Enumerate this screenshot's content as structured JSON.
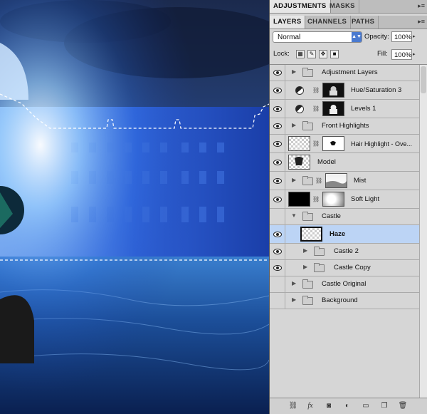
{
  "panel_tabs_top": [
    {
      "label": "ADJUSTMENTS",
      "active": true
    },
    {
      "label": "MASKS",
      "active": false
    }
  ],
  "panel_tabs": [
    {
      "label": "LAYERS",
      "active": true
    },
    {
      "label": "CHANNELS",
      "active": false
    },
    {
      "label": "PATHS",
      "active": false
    }
  ],
  "blend_mode": "Normal",
  "opacity_label": "Opacity:",
  "opacity_value": "100%",
  "lock_label": "Lock:",
  "fill_label": "Fill:",
  "fill_value": "100%",
  "layers": [
    {
      "name": "Adjustment Layers",
      "type": "group",
      "visible": true
    },
    {
      "name": "Hue/Saturation 3",
      "type": "adjustment",
      "visible": true
    },
    {
      "name": "Levels 1",
      "type": "adjustment",
      "visible": true
    },
    {
      "name": "Front Highlights",
      "type": "group",
      "visible": true
    },
    {
      "name": "Hair Highlight - Ove...",
      "type": "masked",
      "visible": true
    },
    {
      "name": "Model",
      "type": "pixel",
      "visible": true
    },
    {
      "name": "Mist",
      "type": "group-masked",
      "visible": true
    },
    {
      "name": "Soft Light",
      "type": "masked",
      "visible": true
    },
    {
      "name": "Castle",
      "type": "group-open",
      "visible": false
    },
    {
      "name": "Haze",
      "type": "pixel",
      "visible": true,
      "selected": true
    },
    {
      "name": "Castle 2",
      "type": "group",
      "visible": true
    },
    {
      "name": "Castle Copy",
      "type": "group",
      "visible": true
    },
    {
      "name": "Castle Original",
      "type": "group",
      "visible": false
    },
    {
      "name": "Background",
      "type": "group",
      "visible": false
    }
  ],
  "colors": {
    "selection": "#bcd4f5",
    "panel_bg": "#d6d6d6",
    "accent": "#4a7ad0"
  }
}
